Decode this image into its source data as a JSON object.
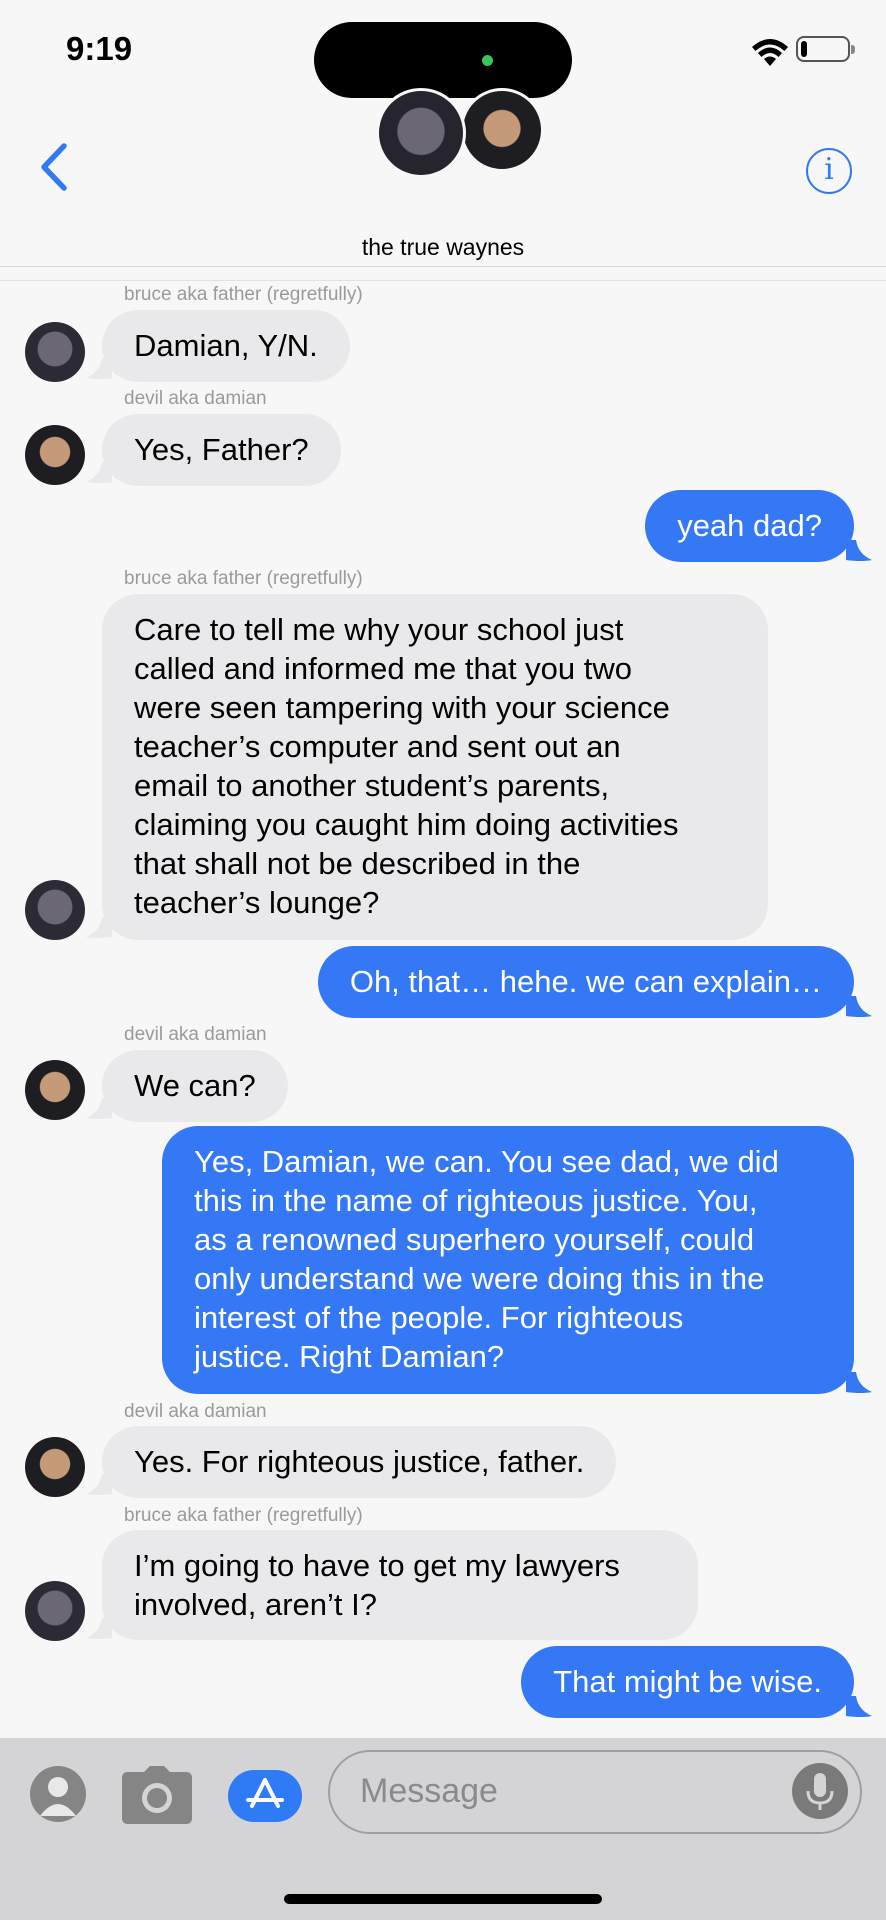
{
  "status": {
    "time": "9:19"
  },
  "header": {
    "title": "the true waynes"
  },
  "messages": [
    {
      "sender": "bruce aka father (regretfully)",
      "text": "Damian, Y/N."
    },
    {
      "sender": "devil aka damian",
      "text": "Yes, Father?"
    },
    {
      "text": "yeah dad?"
    },
    {
      "sender": "bruce aka father (regretfully)",
      "text": "Care to tell me why your school just\ncalled and informed me that you two\nwere seen tampering with your science\nteacher’s computer and sent out an\nemail to another student’s parents,\nclaiming you caught him doing activities\nthat shall not be described in the\nteacher’s lounge?"
    },
    {
      "text": "Oh, that… hehe. we can explain…"
    },
    {
      "sender": "devil aka damian",
      "text": "We can?"
    },
    {
      "text": "Yes, Damian, we can. You see dad, we did\nthis in the name of righteous justice. You,\nas a renowned superhero yourself, could\nonly understand we were doing this in the\ninterest of the people. For righteous\njustice. Right Damian?"
    },
    {
      "sender": "devil aka damian",
      "text": "Yes. For righteous justice, father."
    },
    {
      "sender": "bruce aka father (regretfully)",
      "text": "I’m going to have to get my lawyers\ninvolved, aren’t I?"
    },
    {
      "text": "That might be wise."
    }
  ],
  "input": {
    "placeholder": "Message"
  },
  "colors": {
    "accent": "#3478f6",
    "incoming": "#e9e9eb",
    "background": "#f7f7f7"
  },
  "icons": [
    "back-chevron-icon",
    "info-icon",
    "contact-icon",
    "camera-icon",
    "app-store-icon",
    "microphone-icon",
    "wifi-icon",
    "battery-icon"
  ]
}
